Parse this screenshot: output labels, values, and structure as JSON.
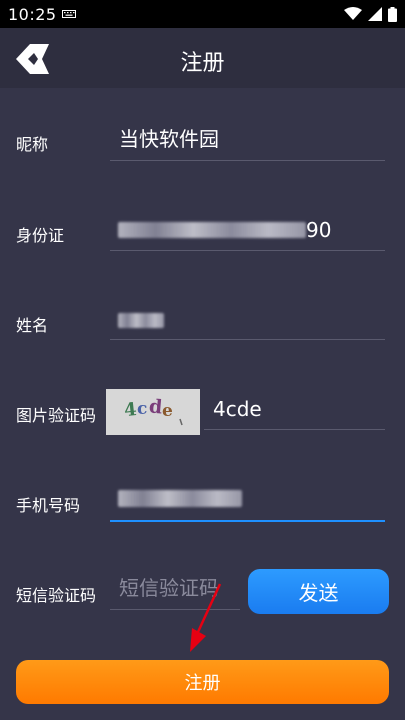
{
  "status": {
    "time": "10:25",
    "icons": [
      "keyboard-icon",
      "wifi-icon",
      "cell-signal-icon",
      "battery-icon"
    ]
  },
  "appbar": {
    "title": "注册",
    "back_icon": "back-arrow-icon"
  },
  "form": {
    "nickname": {
      "label": "昵称",
      "value": "当快软件园"
    },
    "id_card": {
      "label": "身份证",
      "visible_suffix": "90"
    },
    "name": {
      "label": "姓名"
    },
    "captcha": {
      "label": "图片验证码",
      "image_text": "4cde",
      "value": "4cde"
    },
    "phone": {
      "label": "手机号码"
    },
    "sms": {
      "label": "短信验证码",
      "placeholder": "短信验证码",
      "send_label": "发送"
    }
  },
  "submit": {
    "label": "注册"
  },
  "colors": {
    "background": "#353549",
    "send": "#1a7cf0",
    "submit": "#ff7a00",
    "arrow": "#e60012"
  }
}
